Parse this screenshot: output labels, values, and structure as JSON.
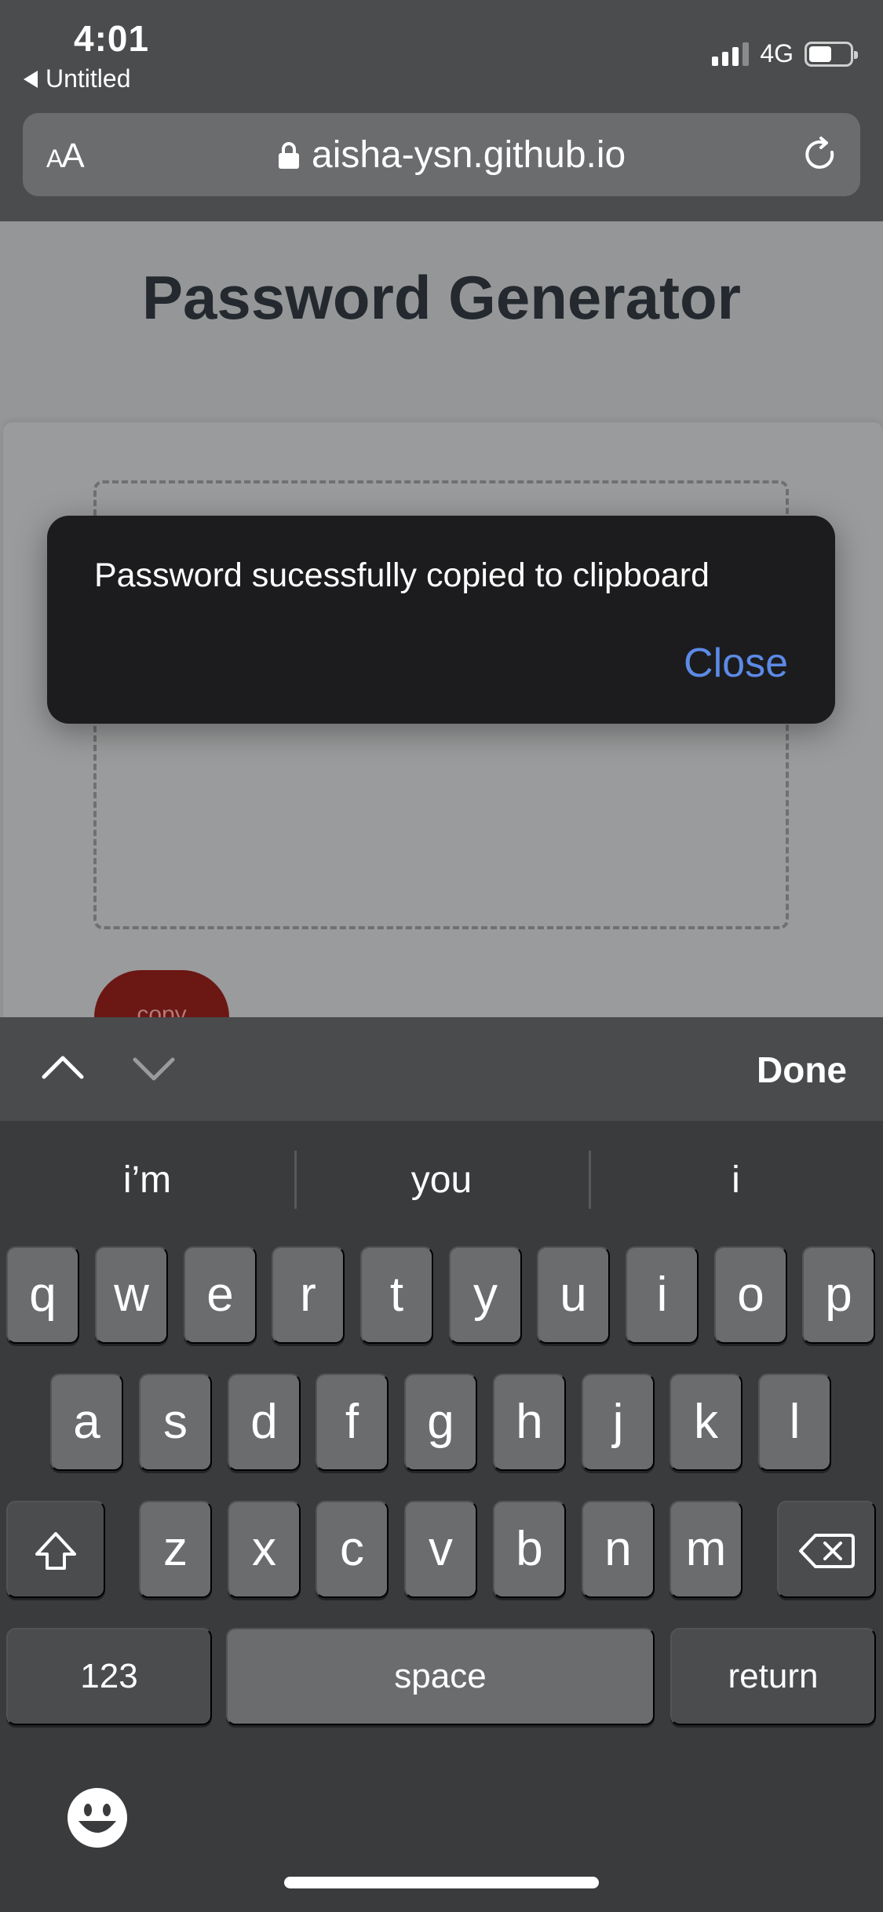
{
  "status_bar": {
    "time": "4:01",
    "back_app": "Untitled",
    "network": "4G",
    "signal_bars_on": 3,
    "signal_bars_total": 4,
    "battery_level": 0.55
  },
  "url_bar": {
    "text_size": "AA",
    "url": "aisha-ysn.github.io"
  },
  "page": {
    "title": "Password Generator",
    "copy_button": "copy"
  },
  "alert": {
    "message": "Password sucessfully copied to clipboard",
    "close_label": "Close"
  },
  "accessory_bar": {
    "done_label": "Done"
  },
  "keyboard": {
    "suggestions": [
      "i’m",
      "you",
      "i"
    ],
    "row1": [
      "q",
      "w",
      "e",
      "r",
      "t",
      "y",
      "u",
      "i",
      "o",
      "p"
    ],
    "row2": [
      "a",
      "s",
      "d",
      "f",
      "g",
      "h",
      "j",
      "k",
      "l"
    ],
    "row3": [
      "z",
      "x",
      "c",
      "v",
      "b",
      "n",
      "m"
    ],
    "numbers_label": "123",
    "space_label": "space",
    "return_label": "return"
  },
  "colors": {
    "alert_bg": "#1c1c1e",
    "alert_link": "#5c8ae6",
    "copy_button": "#6b1714",
    "page_dim": "#959697"
  }
}
